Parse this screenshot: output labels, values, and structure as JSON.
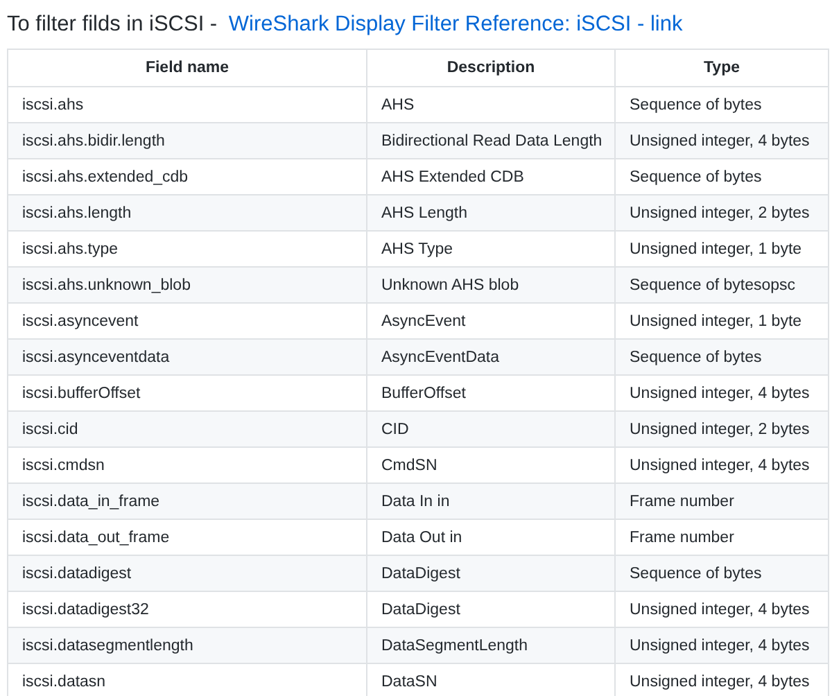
{
  "heading": {
    "text": "To filter filds in iSCSI - ",
    "link": "WireShark Display Filter Reference: iSCSI - link"
  },
  "table": {
    "columns": [
      "Field name",
      "Description",
      "Type"
    ],
    "rows": [
      [
        "iscsi.ahs",
        "AHS",
        "Sequence of bytes"
      ],
      [
        "iscsi.ahs.bidir.length",
        "Bidirectional Read Data Length",
        "Unsigned integer, 4 bytes"
      ],
      [
        "iscsi.ahs.extended_cdb",
        "AHS Extended CDB",
        "Sequence of bytes"
      ],
      [
        "iscsi.ahs.length",
        "AHS Length",
        "Unsigned integer, 2 bytes"
      ],
      [
        "iscsi.ahs.type",
        "AHS Type",
        "Unsigned integer, 1 byte"
      ],
      [
        "iscsi.ahs.unknown_blob",
        "Unknown AHS blob",
        "Sequence of bytesopsc"
      ],
      [
        "iscsi.asyncevent",
        "AsyncEvent",
        "Unsigned integer, 1 byte"
      ],
      [
        "iscsi.asynceventdata",
        "AsyncEventData",
        "Sequence of bytes"
      ],
      [
        "iscsi.bufferOffset",
        "BufferOffset",
        "Unsigned integer, 4 bytes"
      ],
      [
        "iscsi.cid",
        "CID",
        "Unsigned integer, 2 bytes"
      ],
      [
        "iscsi.cmdsn",
        "CmdSN",
        "Unsigned integer, 4 bytes"
      ],
      [
        "iscsi.data_in_frame",
        "Data In in",
        "Frame number"
      ],
      [
        "iscsi.data_out_frame",
        "Data Out in",
        "Frame number"
      ],
      [
        "iscsi.datadigest",
        "DataDigest",
        "Sequence of bytes"
      ],
      [
        "iscsi.datadigest32",
        "DataDigest",
        "Unsigned integer, 4 bytes"
      ],
      [
        "iscsi.datasegmentlength",
        "DataSegmentLength",
        "Unsigned integer, 4 bytes"
      ],
      [
        "iscsi.datasn",
        "DataSN",
        "Unsigned integer, 4 bytes"
      ]
    ]
  }
}
